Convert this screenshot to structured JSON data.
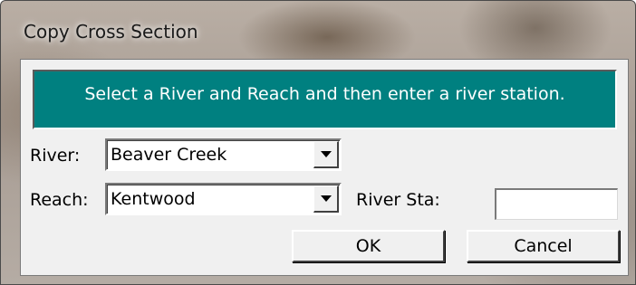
{
  "window": {
    "title": "Copy Cross Section"
  },
  "banner": {
    "text": "Select a River and Reach and then enter a river station.",
    "color": "#008080"
  },
  "river": {
    "label": "River:",
    "value": "Beaver Creek"
  },
  "reach": {
    "label": "Reach:",
    "value": "Kentwood"
  },
  "river_station": {
    "label": "River Sta:",
    "value": ""
  },
  "buttons": {
    "ok": "OK",
    "cancel": "Cancel"
  }
}
